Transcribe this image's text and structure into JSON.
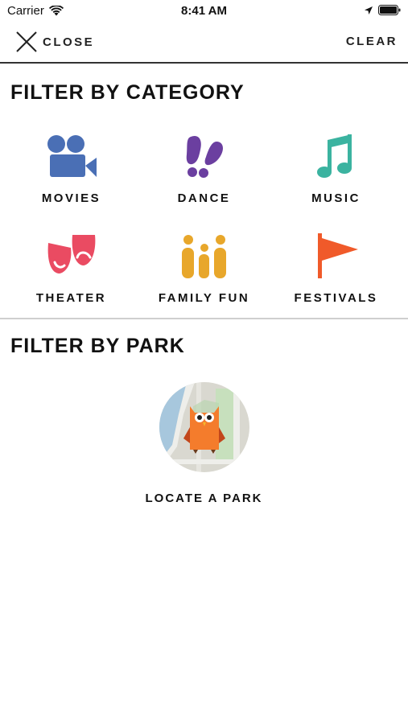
{
  "status": {
    "carrier": "Carrier",
    "time": "8:41 AM"
  },
  "nav": {
    "close_label": "CLOSE",
    "clear_label": "CLEAR"
  },
  "category_section": {
    "title": "FILTER BY CATEGORY",
    "items": [
      {
        "label": "MOVIES",
        "icon": "movie-camera-icon",
        "color": "#4a6fb5"
      },
      {
        "label": "DANCE",
        "icon": "footprints-icon",
        "color": "#6b3fa0"
      },
      {
        "label": "MUSIC",
        "icon": "music-note-icon",
        "color": "#3bb3a0"
      },
      {
        "label": "THEATER",
        "icon": "theater-masks-icon",
        "color": "#ea4b62"
      },
      {
        "label": "FAMILY FUN",
        "icon": "family-icon",
        "color": "#e8a72b"
      },
      {
        "label": "FESTIVALS",
        "icon": "flag-icon",
        "color": "#f05a2a"
      }
    ]
  },
  "park_section": {
    "title": "FILTER BY PARK",
    "locate_label": "LOCATE A PARK",
    "icon": "owl-map-icon"
  }
}
